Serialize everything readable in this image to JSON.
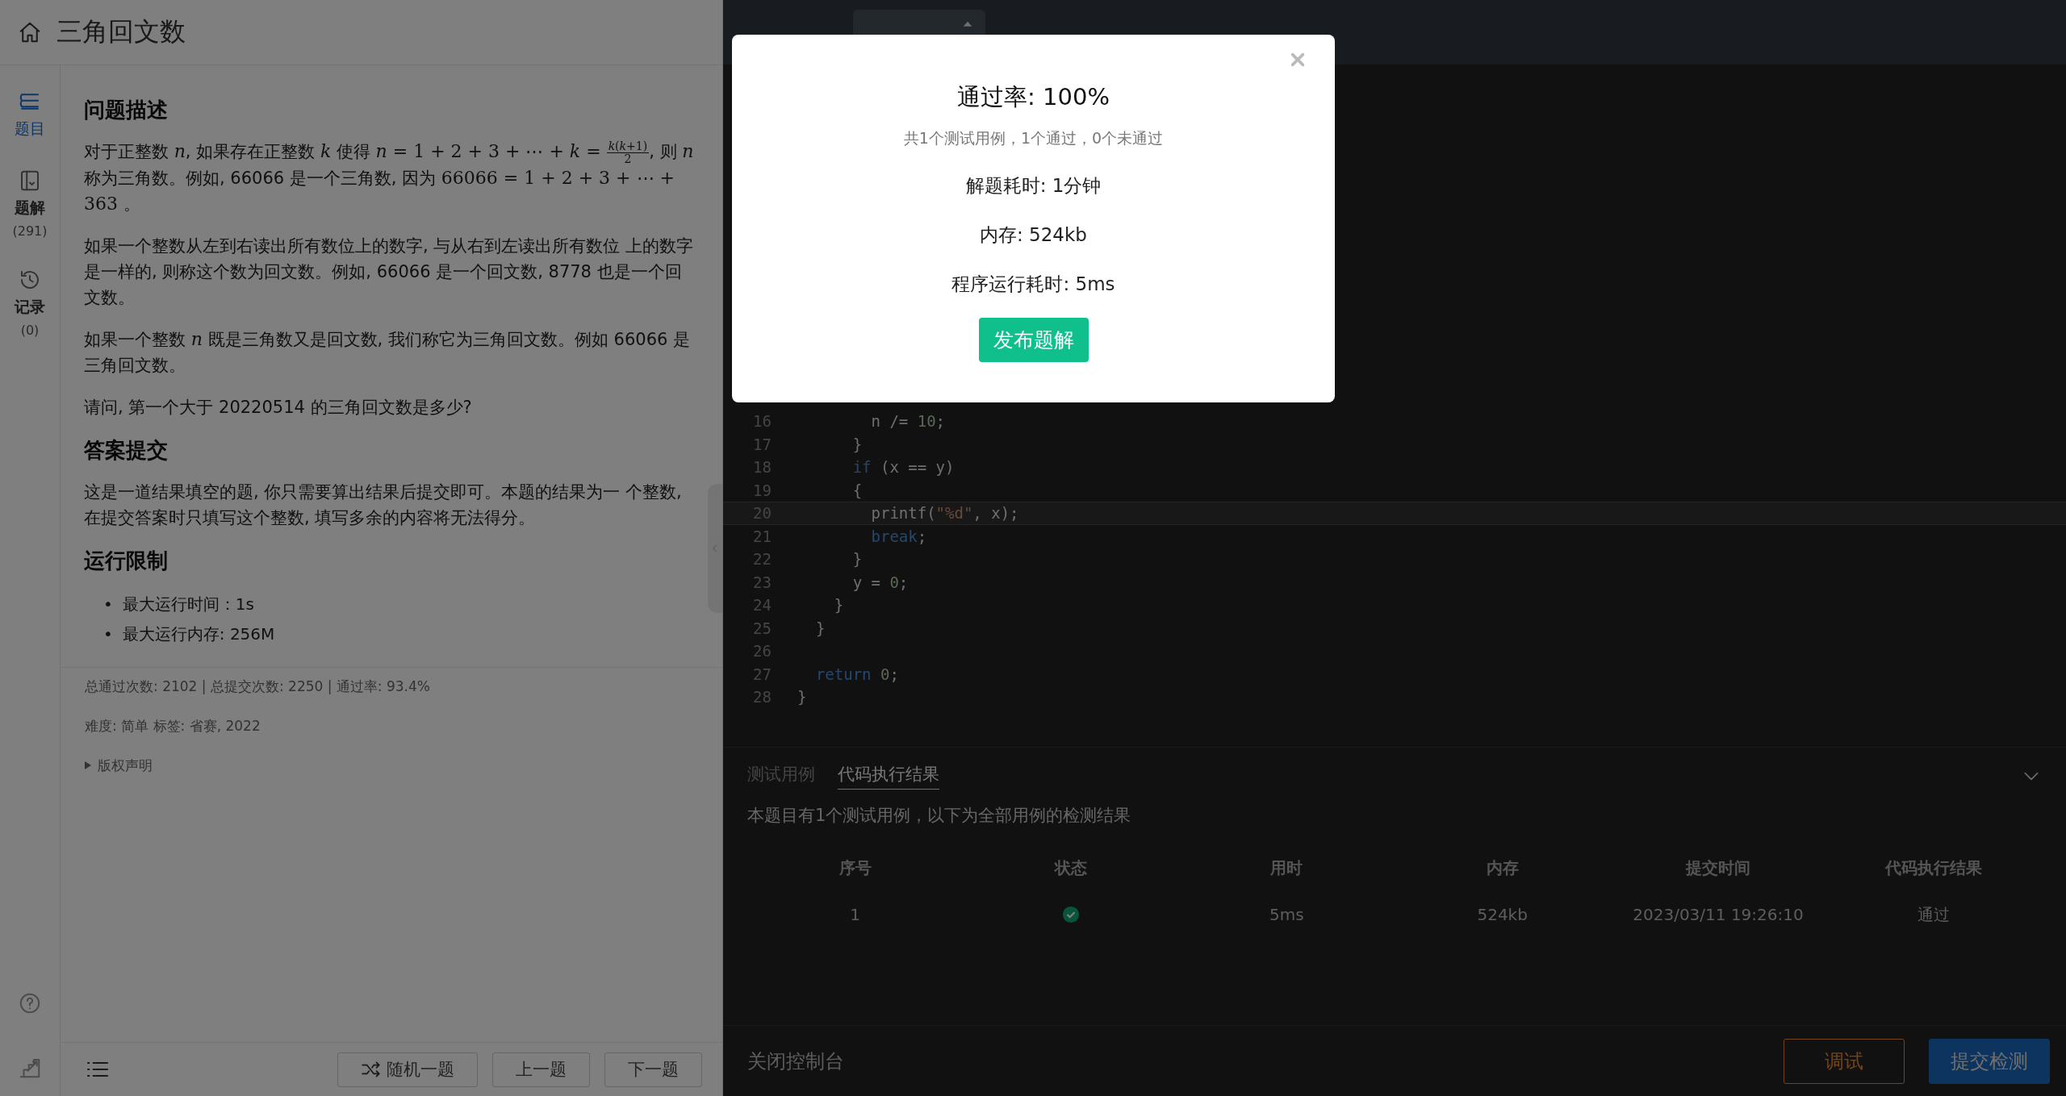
{
  "header": {
    "title": "三角回文数"
  },
  "sidebar": {
    "items": [
      {
        "kind": "problem",
        "label": "题目",
        "selected": true
      },
      {
        "kind": "solution",
        "label": "题解",
        "count": "(291)",
        "selected": false
      },
      {
        "kind": "history",
        "label": "记录",
        "count": "(0)",
        "selected": false
      }
    ]
  },
  "problem": {
    "sections": [
      {
        "heading": "问题描述",
        "blocks": [
          {
            "kind": "para",
            "parts": [
              {
                "kind": "text",
                "text": "对于正整数 "
              },
              {
                "kind": "math",
                "text": "*n*"
              },
              {
                "kind": "text",
                "text": ", 如果存在正整数 "
              },
              {
                "kind": "math",
                "text": "*k*"
              },
              {
                "kind": "text",
                "text": " 使得 "
              },
              {
                "kind": "math",
                "text": "*n* = 1 + 2 + 3 + ⋯ + *k* = "
              },
              {
                "kind": "frac",
                "num": "*k*(*k*+1)",
                "den": "2"
              },
              {
                "kind": "text",
                "text": ", 则 "
              },
              {
                "kind": "math",
                "text": "*n*"
              },
              {
                "kind": "text",
                "text": " 称为三角数。例如, 66066 是一个三角数, 因为 "
              },
              {
                "kind": "math",
                "text": "66066 = 1 + 2 + 3 + ⋯ + 363"
              },
              {
                "kind": "text",
                "text": " 。"
              }
            ]
          },
          {
            "kind": "para",
            "parts": [
              {
                "kind": "text",
                "text": "如果一个整数从左到右读出所有数位上的数字, 与从右到左读出所有数位 上的数字是一样的, 则称这个数为回文数。例如, 66066 是一个回文数, 8778 也是一个回文数。"
              }
            ]
          },
          {
            "kind": "para",
            "parts": [
              {
                "kind": "text",
                "text": "如果一个整数 "
              },
              {
                "kind": "math",
                "text": "*n*"
              },
              {
                "kind": "text",
                "text": " 既是三角数又是回文数, 我们称它为三角回文数。例如 66066 是三角回文数。"
              }
            ]
          },
          {
            "kind": "para",
            "parts": [
              {
                "kind": "text",
                "text": "请问, 第一个大于 20220514 的三角回文数是多少?"
              }
            ]
          }
        ]
      },
      {
        "heading": "答案提交",
        "blocks": [
          {
            "kind": "para",
            "parts": [
              {
                "kind": "text",
                "text": "这是一道结果填空的题, 你只需要算出结果后提交即可。本题的结果为一 个整数, 在提交答案时只填写这个整数, 填写多余的内容将无法得分。"
              }
            ]
          }
        ]
      },
      {
        "heading": "运行限制",
        "blocks": [
          {
            "kind": "list",
            "items": [
              {
                "bullet": "•",
                "text": "最大运行时间：1s"
              },
              {
                "bullet": "•",
                "text": "最大运行内存: 256M"
              }
            ]
          }
        ]
      }
    ],
    "stats": "总通过次数: 2102  |  总提交次数: 2250  |  通过率: 93.4%",
    "meta": "难度: 简单   标签: 省赛, 2022",
    "copyright": {
      "label": "版权声明",
      "expanded": false
    }
  },
  "nav": {
    "buttons": [
      {
        "kind": "random",
        "label": "随机一题"
      },
      {
        "kind": "plain",
        "label": "上一题"
      },
      {
        "kind": "plain",
        "label": "下一题"
      }
    ]
  },
  "editor": {
    "lines": [
      {
        "num": "16",
        "current": false,
        "tokens": [
          {
            "kind": "plain",
            "text": "        n /= "
          },
          {
            "kind": "number",
            "text": "10"
          },
          {
            "kind": "plain",
            "text": ";"
          }
        ]
      },
      {
        "num": "17",
        "current": false,
        "tokens": [
          {
            "kind": "plain",
            "text": "      }"
          }
        ]
      },
      {
        "num": "18",
        "current": false,
        "tokens": [
          {
            "kind": "keyword",
            "text": "      if"
          },
          {
            "kind": "plain",
            "text": " (x == y)"
          }
        ]
      },
      {
        "num": "19",
        "current": false,
        "tokens": [
          {
            "kind": "plain",
            "text": "      {"
          }
        ]
      },
      {
        "num": "20",
        "current": true,
        "tokens": [
          {
            "kind": "plain",
            "text": "        printf("
          },
          {
            "kind": "string",
            "text": "\"%d\""
          },
          {
            "kind": "plain",
            "text": ", x);"
          }
        ]
      },
      {
        "num": "21",
        "current": false,
        "tokens": [
          {
            "kind": "keyword",
            "text": "        break"
          },
          {
            "kind": "plain",
            "text": ";"
          }
        ]
      },
      {
        "num": "22",
        "current": false,
        "tokens": [
          {
            "kind": "plain",
            "text": "      }"
          }
        ]
      },
      {
        "num": "23",
        "current": false,
        "tokens": [
          {
            "kind": "plain",
            "text": "      y = "
          },
          {
            "kind": "number",
            "text": "0"
          },
          {
            "kind": "plain",
            "text": ";"
          }
        ]
      },
      {
        "num": "24",
        "current": false,
        "tokens": [
          {
            "kind": "plain",
            "text": "    }"
          }
        ]
      },
      {
        "num": "25",
        "current": false,
        "tokens": [
          {
            "kind": "plain",
            "text": "  }"
          }
        ]
      },
      {
        "num": "26",
        "current": false
      },
      {
        "num": "27",
        "current": false,
        "tokens": [
          {
            "kind": "keyword",
            "text": "  return "
          },
          {
            "kind": "number",
            "text": "0"
          },
          {
            "kind": "plain",
            "text": ";"
          }
        ]
      },
      {
        "num": "28",
        "current": false,
        "tokens": [
          {
            "kind": "plain",
            "text": "}"
          }
        ]
      }
    ]
  },
  "console": {
    "tabs": [
      {
        "label": "测试用例",
        "selected": false
      },
      {
        "label": "代码执行结果",
        "selected": true
      }
    ],
    "summary": "本题目有1个测试用例，以下为全部用例的检测结果",
    "columns": [
      "序号",
      "状态",
      "用时",
      "内存",
      "提交时间",
      "代码执行结果"
    ],
    "rows": [
      {
        "index": "1",
        "passed": true,
        "time": "5ms",
        "memory": "524kb",
        "submitted": "2023/03/11 19:26:10",
        "result": "通过"
      }
    ],
    "close_label": "关闭控制台",
    "buttons": [
      {
        "kind": "outline",
        "label": "调试"
      },
      {
        "kind": "primary",
        "label": "提交检测"
      }
    ]
  },
  "dialog": {
    "title": "通过率: 100%",
    "subtitle": "共1个测试用例，1个通过，0个未通过",
    "lines": [
      "解题耗时: 1分钟",
      "内存: 524kb",
      "程序运行耗时: 5ms"
    ],
    "button": "发布题解"
  }
}
